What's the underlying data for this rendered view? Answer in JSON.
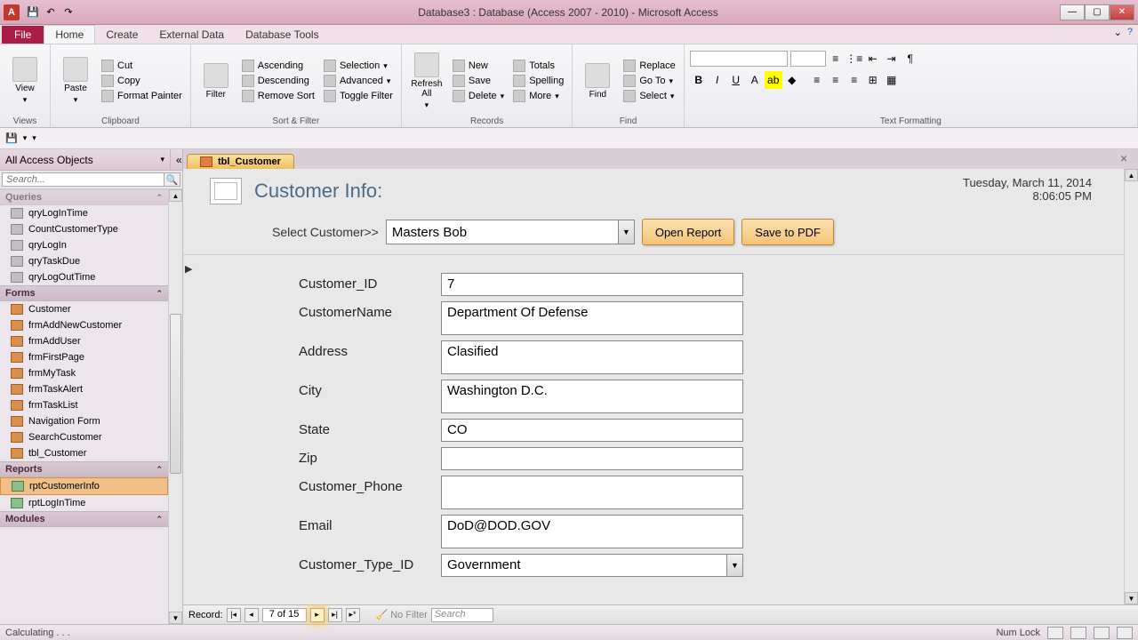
{
  "titlebar": {
    "title": "Database3 : Database (Access 2007 - 2010) - Microsoft Access"
  },
  "ribbon": {
    "file": "File",
    "tabs": [
      "Home",
      "Create",
      "External Data",
      "Database Tools"
    ],
    "activeTab": "Home",
    "groups": {
      "views": {
        "label": "Views",
        "view": "View"
      },
      "clipboard": {
        "label": "Clipboard",
        "paste": "Paste",
        "cut": "Cut",
        "copy": "Copy",
        "formatPainter": "Format Painter"
      },
      "sortFilter": {
        "label": "Sort & Filter",
        "filter": "Filter",
        "ascending": "Ascending",
        "descending": "Descending",
        "removeSort": "Remove Sort",
        "selection": "Selection",
        "advanced": "Advanced",
        "toggleFilter": "Toggle Filter"
      },
      "records": {
        "label": "Records",
        "refresh": "Refresh\nAll",
        "new": "New",
        "save": "Save",
        "delete": "Delete",
        "totals": "Totals",
        "spelling": "Spelling",
        "more": "More"
      },
      "find": {
        "label": "Find",
        "find": "Find",
        "replace": "Replace",
        "goto": "Go To",
        "select": "Select"
      },
      "textFormatting": {
        "label": "Text Formatting"
      }
    }
  },
  "nav": {
    "header": "All Access Objects",
    "searchPlaceholder": "Search...",
    "queriesHeader": "Queries",
    "queries": [
      "qryLogInTime",
      "CountCustomerType",
      "qryLogIn",
      "qryTaskDue",
      "qryLogOutTime"
    ],
    "formsHeader": "Forms",
    "forms": [
      "Customer",
      "frmAddNewCustomer",
      "frmAddUser",
      "frmFirstPage",
      "frmMyTask",
      "frmTaskAlert",
      "frmTaskList",
      "Navigation Form",
      "SearchCustomer",
      "tbl_Customer"
    ],
    "reportsHeader": "Reports",
    "reports": [
      "rptCustomerInfo",
      "rptLogInTime"
    ],
    "modulesHeader": "Modules"
  },
  "doc": {
    "tabLabel": "tbl_Customer",
    "formTitle": "Customer Info:",
    "date": "Tuesday, March 11, 2014",
    "time": "8:06:05 PM",
    "selectLabel": "Select Customer>>",
    "selectValue": "Masters Bob",
    "openReport": "Open Report",
    "saveToPdf": "Save to PDF",
    "fields": {
      "customerId": {
        "label": "Customer_ID",
        "value": "7"
      },
      "customerName": {
        "label": "CustomerName",
        "value": "Department Of Defense"
      },
      "address": {
        "label": "Address",
        "value": "Clasified"
      },
      "city": {
        "label": "City",
        "value": "Washington D.C."
      },
      "state": {
        "label": "State",
        "value": "CO"
      },
      "zip": {
        "label": "Zip",
        "value": ""
      },
      "phone": {
        "label": "Customer_Phone",
        "value": ""
      },
      "email": {
        "label": "Email",
        "value": "DoD@DOD.GOV"
      },
      "type": {
        "label": "Customer_Type_ID",
        "value": "Government"
      }
    }
  },
  "recnav": {
    "label": "Record:",
    "pos": "7 of 15",
    "noFilter": "No Filter",
    "search": "Search"
  },
  "status": {
    "left": "Calculating . . .",
    "numlock": "Num Lock"
  }
}
